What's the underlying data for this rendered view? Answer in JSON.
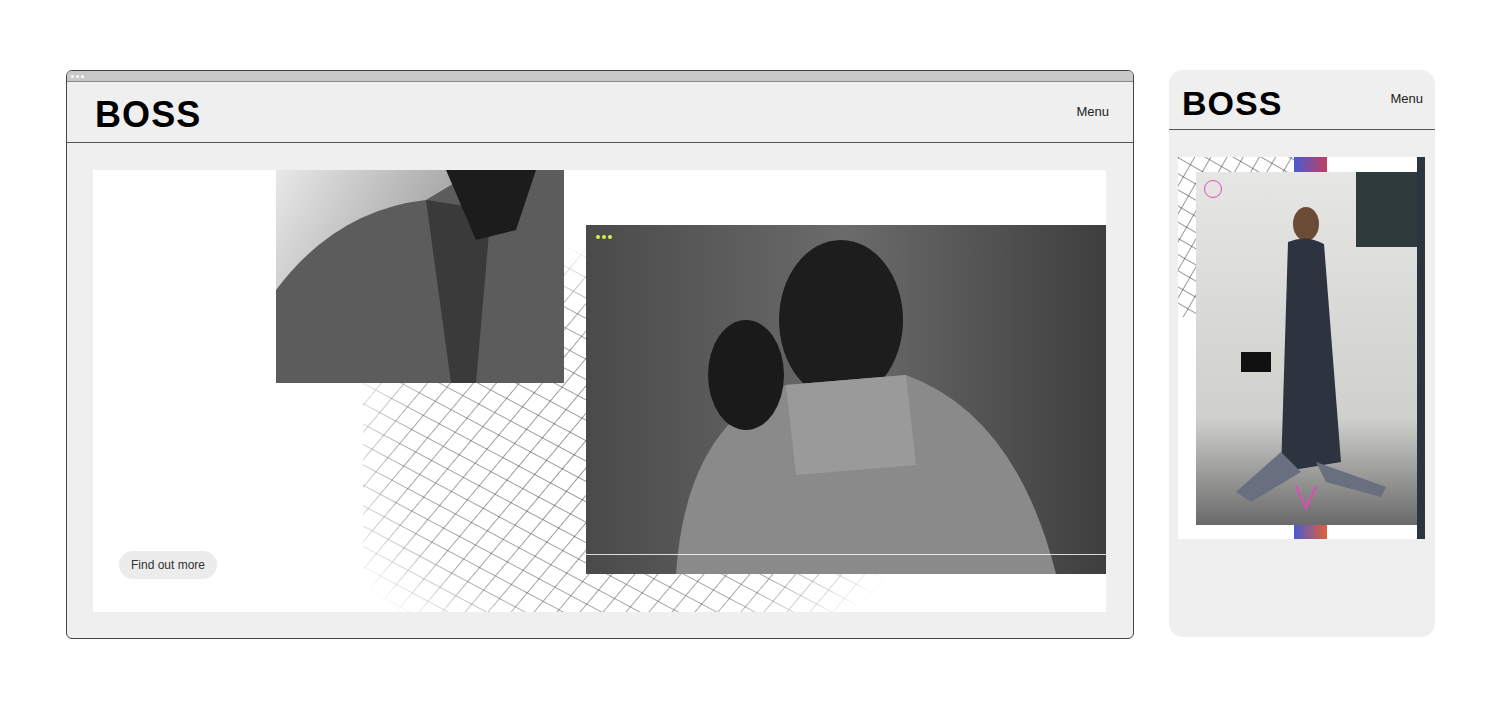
{
  "desktop": {
    "logo": "BOSS",
    "menu": "Menu",
    "cta": "Find out more"
  },
  "mobile": {
    "logo": "BOSS",
    "menu": "Menu"
  }
}
